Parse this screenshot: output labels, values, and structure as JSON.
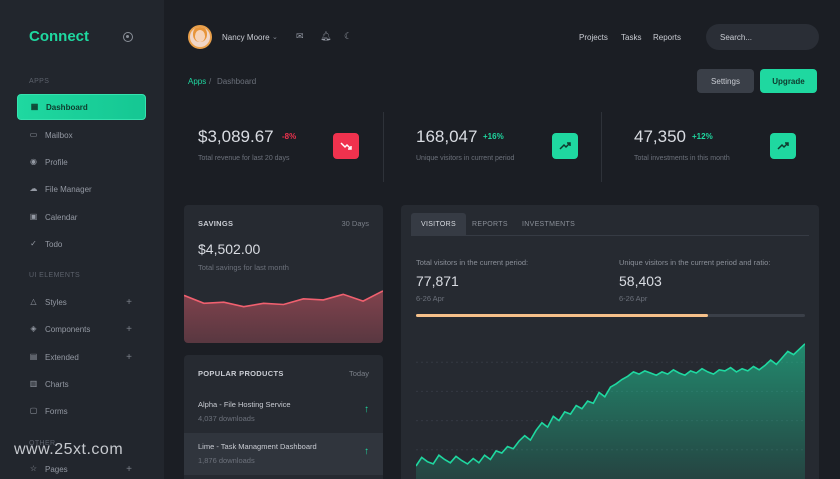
{
  "sidebar": {
    "brand": "Connect",
    "sections": [
      "Apps",
      "UI Elements",
      "Other"
    ],
    "items": [
      {
        "label": "Dashboard",
        "icon": "grid-icon"
      },
      {
        "label": "Mailbox",
        "icon": "inbox-icon"
      },
      {
        "label": "Profile",
        "icon": "user-icon"
      },
      {
        "label": "File Manager",
        "icon": "cloud-icon"
      },
      {
        "label": "Calendar",
        "icon": "calendar-icon"
      },
      {
        "label": "Todo",
        "icon": "check-icon"
      },
      {
        "label": "Styles",
        "icon": "triangle-icon"
      },
      {
        "label": "Components",
        "icon": "layers-icon"
      },
      {
        "label": "Extended",
        "icon": "briefcase-icon"
      },
      {
        "label": "Charts",
        "icon": "bar-chart-icon"
      },
      {
        "label": "Forms",
        "icon": "form-icon"
      },
      {
        "label": "Pages",
        "icon": "star-icon"
      }
    ]
  },
  "header": {
    "user_name": "Nancy Moore",
    "links": [
      "Projects",
      "Tasks",
      "Reports"
    ],
    "search_placeholder": "Search..."
  },
  "breadcrumb": {
    "parent": "Apps",
    "separator": "/",
    "current": "Dashboard"
  },
  "actions": {
    "settings": "Settings",
    "upgrade": "Upgrade"
  },
  "stats": [
    {
      "value": "$3,089.67",
      "delta": "-8%",
      "caption": "Total revenue for last 20 days",
      "trend": "down",
      "color": "#f0324e"
    },
    {
      "value": "168,047",
      "delta": "+16%",
      "caption": "Unique visitors in current period",
      "trend": "up",
      "color": "#1fd8a0"
    },
    {
      "value": "47,350",
      "delta": "+12%",
      "caption": "Total investments in this month",
      "trend": "up",
      "color": "#1fd8a0"
    }
  ],
  "savings": {
    "title": "SAVINGS",
    "period": "30 Days",
    "value": "$4,502.00",
    "caption": "Total savings for last month",
    "series": [
      42,
      35,
      36,
      32,
      35,
      34,
      39,
      38,
      43,
      37,
      46
    ]
  },
  "popular": {
    "title": "POPULAR PRODUCTS",
    "period": "Today",
    "items": [
      {
        "name": "Alpha - File Hosting Service",
        "downloads": "4,037 downloads"
      },
      {
        "name": "Lime - Task Managment Dashboard",
        "downloads": "1,876 downloads"
      }
    ]
  },
  "visitors": {
    "tabs": [
      "VISITORS",
      "REPORTS",
      "INVESTMENTS"
    ],
    "left": {
      "label": "Total visitors in the current period:",
      "value": "77,871",
      "range": "6-26 Apr"
    },
    "right": {
      "label": "Unique visitors in the current period and ratio:",
      "value": "58,403",
      "range": "6-26 Apr"
    },
    "progress": 0.75,
    "progress_color": "#f5c08a",
    "series": [
      12,
      20,
      16,
      14,
      22,
      18,
      15,
      21,
      17,
      14,
      19,
      15,
      22,
      18,
      26,
      24,
      30,
      28,
      35,
      40,
      36,
      45,
      52,
      48,
      58,
      54,
      62,
      60,
      68,
      65,
      72,
      70,
      80,
      76,
      85,
      88,
      92,
      95,
      99,
      97,
      100,
      98,
      96,
      99,
      97,
      101,
      98,
      96,
      100,
      98,
      102,
      99,
      97,
      101,
      100,
      103,
      99,
      102,
      100,
      104,
      101,
      105,
      110,
      106,
      112,
      118,
      115,
      120,
      125
    ]
  },
  "watermark": "www.25xt.com"
}
